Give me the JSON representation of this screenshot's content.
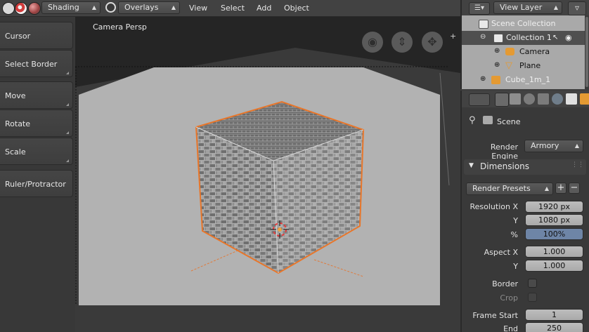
{
  "header": {
    "shading_label": "Shading",
    "overlays_label": "Overlays",
    "menus": [
      "View",
      "Select",
      "Add",
      "Object"
    ]
  },
  "toolbar": {
    "tools": [
      "Cursor",
      "Select Border",
      "Move",
      "Rotate",
      "Scale",
      "Ruler/Protractor"
    ]
  },
  "viewport": {
    "label": "Camera Persp"
  },
  "outliner": {
    "view_layer_label": "View Layer",
    "rows": [
      "Scene Collection",
      "Collection 1",
      "Camera",
      "Plane",
      "Cube_1m_1"
    ]
  },
  "properties": {
    "scene_label": "Scene",
    "render_engine_label": "Render Engine",
    "render_engine_value": "Armory",
    "dimensions_title": "Dimensions",
    "render_presets_label": "Render Presets",
    "resolution_x_label": "Resolution X",
    "resolution_x_value": "1920 px",
    "resolution_y_label": "Y",
    "resolution_y_value": "1080 px",
    "percent_label": "%",
    "percent_value": "100%",
    "aspect_x_label": "Aspect X",
    "aspect_x_value": "1.000",
    "aspect_y_label": "Y",
    "aspect_y_value": "1.000",
    "border_label": "Border",
    "crop_label": "Crop",
    "frame_start_label": "Frame Start",
    "frame_start_value": "1",
    "frame_end_label": "End",
    "frame_end_value": "250"
  },
  "colors": {
    "selection_outline": "#e8762a",
    "panel_bg": "#393939",
    "field_bg": "#b1b1b1"
  }
}
